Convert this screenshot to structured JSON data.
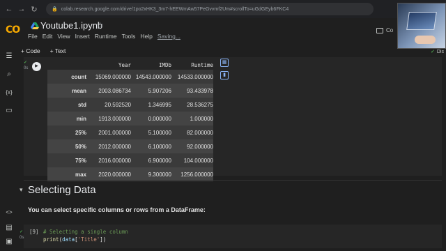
{
  "browser": {
    "url": "colab.research.google.com/drive/1po2xHK3_3m7-hEEWmAw57PeGvvmf2Um#scrollTo=uGdGEyb6FKC4"
  },
  "header": {
    "title": "Youtube1.ipynb",
    "menu": [
      "File",
      "Edit",
      "View",
      "Insert",
      "Runtime",
      "Tools",
      "Help"
    ],
    "saving": "Saving...",
    "comment": "Co"
  },
  "toolbar": {
    "code": "+ Code",
    "text": "+ Text"
  },
  "runtime_label": "Dis",
  "cell_output": {
    "meta_time": "0s",
    "columns": [
      "",
      "Year",
      "IMDb",
      "Runtime"
    ],
    "rows": [
      [
        "count",
        "15069.000000",
        "14543.000000",
        "14533.000000"
      ],
      [
        "mean",
        "2003.086734",
        "5.907206",
        "93.433978"
      ],
      [
        "std",
        "20.592520",
        "1.346995",
        "28.536275"
      ],
      [
        "min",
        "1913.000000",
        "0.000000",
        "1.000000"
      ],
      [
        "25%",
        "2001.000000",
        "5.100000",
        "82.000000"
      ],
      [
        "50%",
        "2012.000000",
        "6.100000",
        "92.000000"
      ],
      [
        "75%",
        "2016.000000",
        "6.900000",
        "104.000000"
      ],
      [
        "max",
        "2020.000000",
        "9.300000",
        "1256.000000"
      ]
    ]
  },
  "section": {
    "title": "Selecting Data",
    "description": "You can select specific columns or rows from a DataFrame:"
  },
  "code_cell": {
    "exec_count": "[9]",
    "meta_time": "0s",
    "comment": "# Selecting a single column",
    "line2_fn": "print",
    "line2_open": "(",
    "line2_var": "data",
    "line2_key_open": "[",
    "line2_key": "'Title'",
    "line2_close": "])"
  }
}
